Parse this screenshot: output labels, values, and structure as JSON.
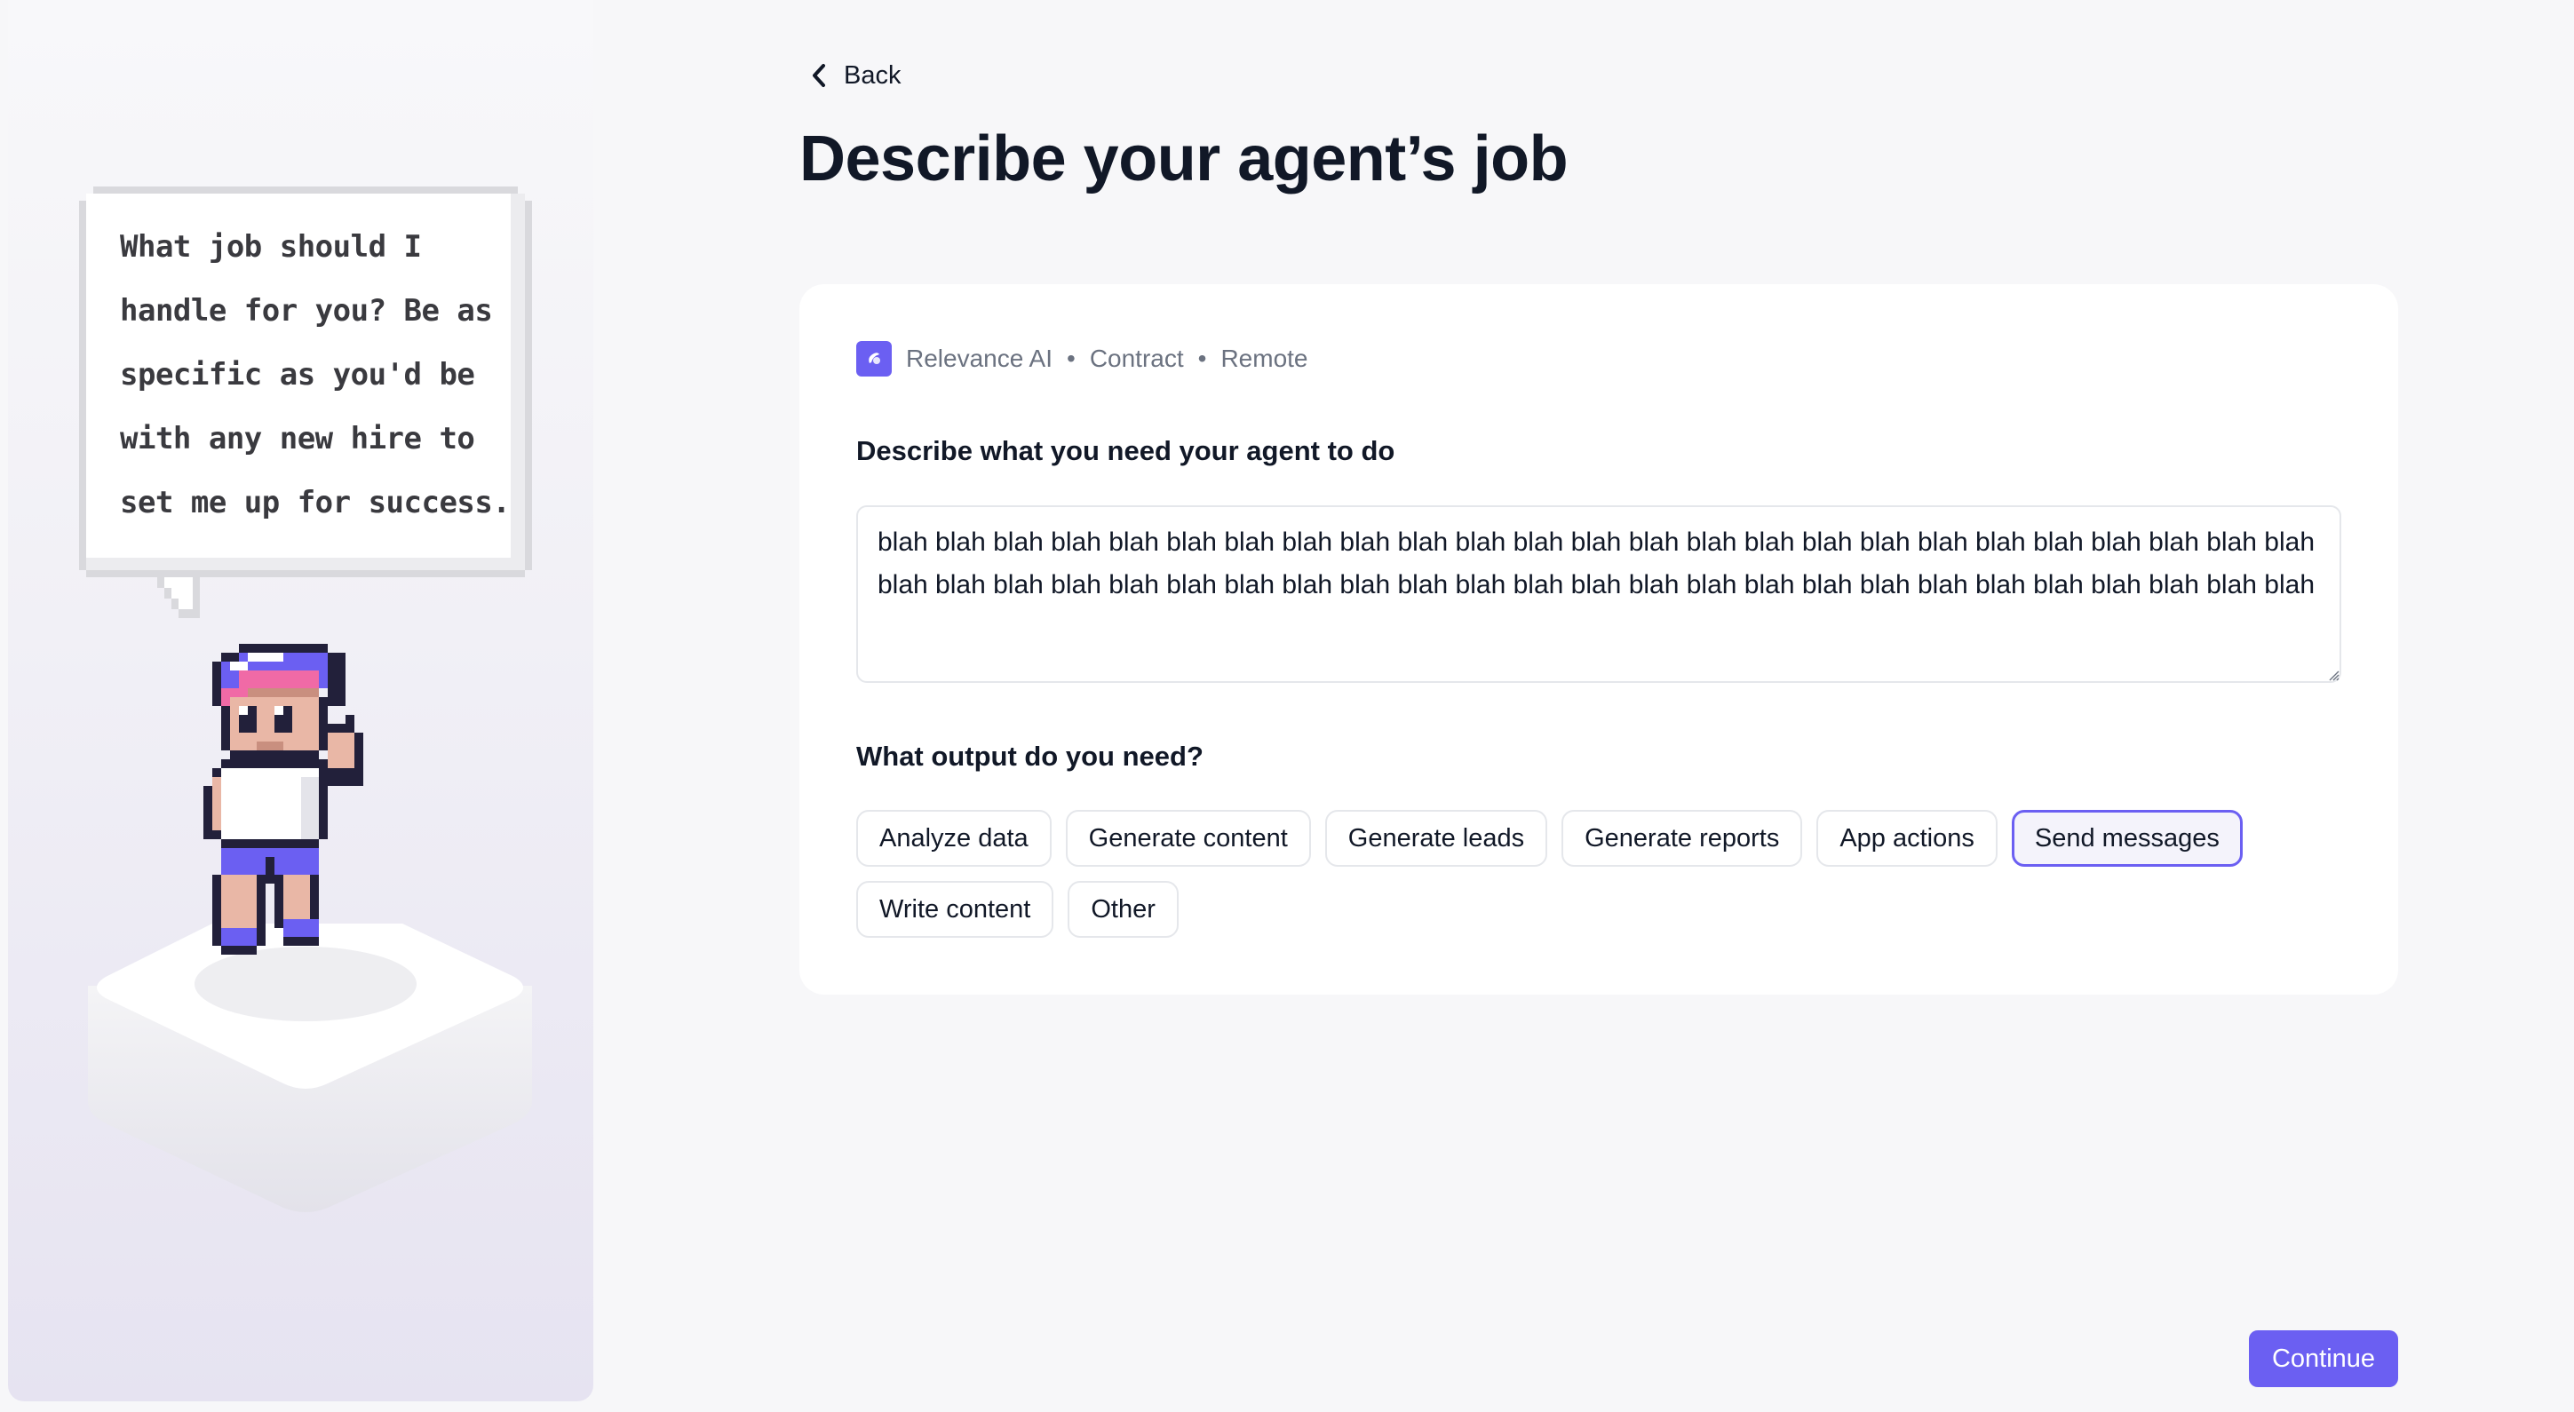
{
  "assistant": {
    "speech": "What job should I handle for you? Be as specific as you'd be with any new hire to set me up for success."
  },
  "header": {
    "back_label": "Back",
    "title": "Describe your agent’s job"
  },
  "job": {
    "company": "Relevance AI",
    "type": "Contract",
    "location": "Remote",
    "separator": "•",
    "brand_color": "#6b5ff2"
  },
  "form": {
    "describe_label": "Describe what you need your agent to do",
    "describe_value": "blah blah blah blah blah blah blah blah blah blah blah blah blah blah blah blah blah blah blah blah blah blah blah blah blah blah blah blah blah blah blah blah blah blah blah blah blah blah blah blah blah blah blah blah blah blah blah blah blah blah",
    "output_label": "What output do you need?",
    "outputs": [
      {
        "label": "Analyze data",
        "selected": false
      },
      {
        "label": "Generate content",
        "selected": false
      },
      {
        "label": "Generate leads",
        "selected": false
      },
      {
        "label": "Generate reports",
        "selected": false
      },
      {
        "label": "App actions",
        "selected": false
      },
      {
        "label": "Send messages",
        "selected": true
      },
      {
        "label": "Write content",
        "selected": false
      },
      {
        "label": "Other",
        "selected": false
      }
    ]
  },
  "footer": {
    "continue_label": "Continue"
  },
  "icons": {
    "back": "chevron-left-icon",
    "brand": "relevance-ai-logo-icon"
  },
  "colors": {
    "accent": "#6b5ff2",
    "title": "#111827",
    "muted": "#6b7280",
    "background": "#f7f7f9"
  }
}
